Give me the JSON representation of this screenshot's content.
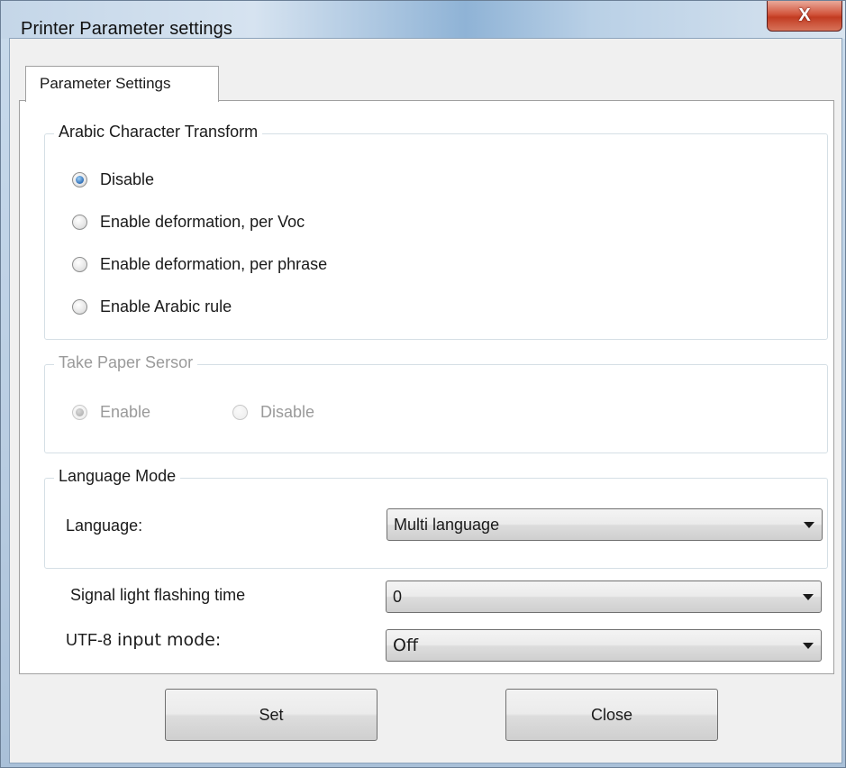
{
  "window": {
    "title": "Printer Parameter settings",
    "close_glyph": "X"
  },
  "tabs": [
    {
      "label": "Parameter Settings",
      "selected": true
    }
  ],
  "arabic_group": {
    "label": "Arabic Character Transform",
    "options": [
      {
        "label": "Disable",
        "checked": true
      },
      {
        "label": "Enable deformation, per Voc",
        "checked": false
      },
      {
        "label": "Enable deformation, per phrase",
        "checked": false
      },
      {
        "label": "Enable Arabic rule",
        "checked": false
      }
    ]
  },
  "paper_sensor_group": {
    "label": "Take Paper Sersor",
    "enabled": false,
    "options": [
      {
        "label": "Enable",
        "checked": true
      },
      {
        "label": "Disable",
        "checked": false
      }
    ]
  },
  "language_group": {
    "label": "Language Mode",
    "language_label": "Language:",
    "language_value": "Multi language"
  },
  "signal_light": {
    "label": "Signal light flashing time",
    "value": "0"
  },
  "utf8": {
    "label_prefix": "UTF-8",
    "label_suffix": " input mode:",
    "value": "Off"
  },
  "buttons": {
    "set_label": "Set",
    "close_label": "Close"
  },
  "colors": {
    "radio_checked": "#2f6fb8",
    "close_button": "#c23c22"
  }
}
